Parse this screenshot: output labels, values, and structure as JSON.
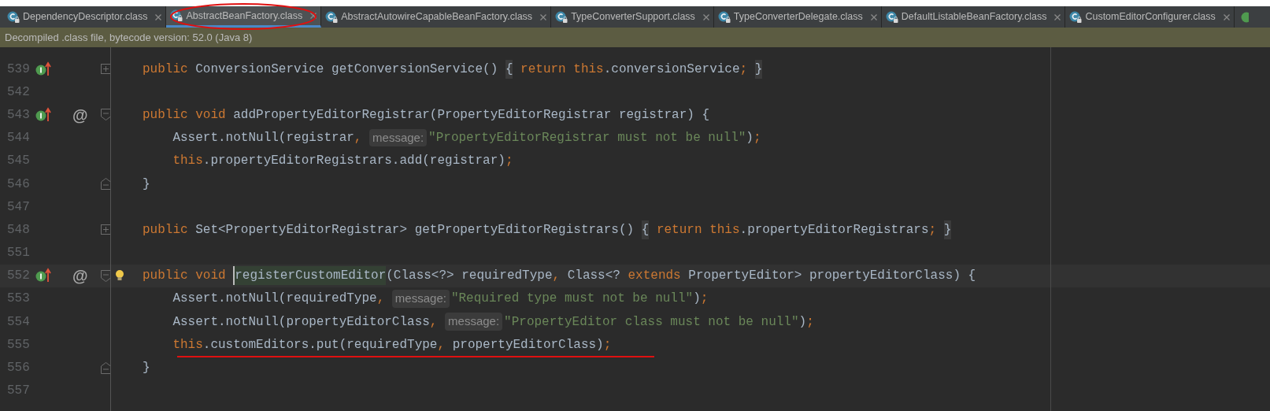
{
  "tabs": [
    {
      "label": "DependencyDescriptor.class",
      "selected": false
    },
    {
      "label": "AbstractBeanFactory.class",
      "selected": true
    },
    {
      "label": "AbstractAutowireCapableBeanFactory.class",
      "selected": false
    },
    {
      "label": "TypeConverterSupport.class",
      "selected": false
    },
    {
      "label": "TypeConverterDelegate.class",
      "selected": false
    },
    {
      "label": "DefaultListableBeanFactory.class",
      "selected": false
    },
    {
      "label": "CustomEditorConfigurer.class",
      "selected": false
    }
  ],
  "banner": "Decompiled .class file, bytecode version: 52.0 (Java 8)",
  "lines": [
    {
      "number": "539",
      "implements": true,
      "fold": {
        "kind": "collapsed"
      },
      "tokens": [
        {
          "kind": "kw",
          "text": "public"
        },
        {
          "kind": "plain",
          "text": " ConversionService getConversionService() "
        },
        {
          "kind": "fold",
          "text": "{"
        },
        {
          "kind": "kw",
          "text": " return this"
        },
        {
          "kind": "plain",
          "text": ".conversionService"
        },
        {
          "kind": "kw",
          "text": "; "
        },
        {
          "kind": "fold",
          "text": "}"
        }
      ]
    },
    {
      "number": "542"
    },
    {
      "number": "543",
      "implements": true,
      "gutter_mark": "@",
      "fold": {
        "kind": "start"
      },
      "tokens": [
        {
          "kind": "kw",
          "text": "public void"
        },
        {
          "kind": "plain",
          "text": " addPropertyEditorRegistrar(PropertyEditorRegistrar registrar) {"
        }
      ]
    },
    {
      "number": "544",
      "tokens": [
        {
          "kind": "plain",
          "text": "    Assert.notNull(registrar"
        },
        {
          "kind": "kw",
          "text": ", "
        },
        {
          "kind": "hint",
          "text": "message:"
        },
        {
          "kind": "str",
          "text": "\"PropertyEditorRegistrar must not be null\""
        },
        {
          "kind": "plain",
          "text": ")"
        },
        {
          "kind": "kw",
          "text": ";"
        }
      ]
    },
    {
      "number": "545",
      "tokens": [
        {
          "kind": "kw",
          "text": "    this"
        },
        {
          "kind": "plain",
          "text": ".propertyEditorRegistrars.add(registrar)"
        },
        {
          "kind": "kw",
          "text": ";"
        }
      ]
    },
    {
      "number": "546",
      "fold": {
        "kind": "end"
      },
      "tokens": [
        {
          "kind": "plain",
          "text": "}"
        }
      ]
    },
    {
      "number": "547"
    },
    {
      "number": "548",
      "fold": {
        "kind": "collapsed"
      },
      "tokens": [
        {
          "kind": "kw",
          "text": "public"
        },
        {
          "kind": "plain",
          "text": " Set<PropertyEditorRegistrar> getPropertyEditorRegistrars() "
        },
        {
          "kind": "fold",
          "text": "{"
        },
        {
          "kind": "kw",
          "text": " return this"
        },
        {
          "kind": "plain",
          "text": ".propertyEditorRegistrars"
        },
        {
          "kind": "kw",
          "text": "; "
        },
        {
          "kind": "fold",
          "text": "}"
        }
      ]
    },
    {
      "number": "551"
    },
    {
      "number": "552",
      "implements": true,
      "gutter_mark": "@",
      "fold": {
        "kind": "start"
      },
      "bulb": true,
      "current": true,
      "tokens": [
        {
          "kind": "kw",
          "text": "public void "
        },
        {
          "kind": "usage",
          "text": "registerCustomEditor"
        },
        {
          "kind": "plain",
          "text": "(Class<?> requiredType"
        },
        {
          "kind": "kw",
          "text": ", "
        },
        {
          "kind": "plain",
          "text": "Class<? "
        },
        {
          "kind": "kw",
          "text": "extends"
        },
        {
          "kind": "plain",
          "text": " PropertyEditor> propertyEditorClass) {"
        }
      ]
    },
    {
      "number": "553",
      "tokens": [
        {
          "kind": "plain",
          "text": "    Assert.notNull(requiredType"
        },
        {
          "kind": "kw",
          "text": ", "
        },
        {
          "kind": "hint",
          "text": "message:"
        },
        {
          "kind": "str",
          "text": "\"Required type must not be null\""
        },
        {
          "kind": "plain",
          "text": ")"
        },
        {
          "kind": "kw",
          "text": ";"
        }
      ]
    },
    {
      "number": "554",
      "tokens": [
        {
          "kind": "plain",
          "text": "    Assert.notNull(propertyEditorClass"
        },
        {
          "kind": "kw",
          "text": ", "
        },
        {
          "kind": "hint",
          "text": "message:"
        },
        {
          "kind": "str",
          "text": "\"PropertyEditor class must not be null\""
        },
        {
          "kind": "plain",
          "text": ")"
        },
        {
          "kind": "kw",
          "text": ";"
        }
      ]
    },
    {
      "number": "555",
      "tokens": [
        {
          "kind": "kw",
          "text": "    this"
        },
        {
          "kind": "plain",
          "text": ".customEditors.put(requiredType"
        },
        {
          "kind": "kw",
          "text": ", "
        },
        {
          "kind": "plain",
          "text": "propertyEditorClass)"
        },
        {
          "kind": "kw",
          "text": ";"
        }
      ]
    },
    {
      "number": "556",
      "fold": {
        "kind": "end"
      },
      "tokens": [
        {
          "kind": "plain",
          "text": "}"
        }
      ]
    },
    {
      "number": "557"
    }
  ]
}
